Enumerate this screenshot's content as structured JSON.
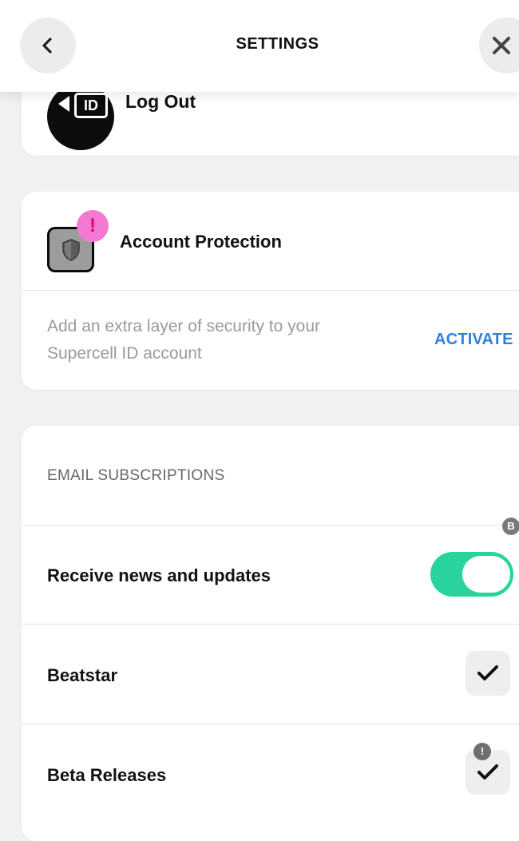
{
  "header": {
    "title": "SETTINGS",
    "back_icon": "chevron-left-icon",
    "close_icon": "close-icon"
  },
  "logout": {
    "label": "Log Out",
    "icon_text": "ID"
  },
  "account_protection": {
    "title": "Account Protection",
    "alert_mark": "!",
    "description": "Add an extra layer of security to your Supercell ID account",
    "action_label": "ACTIVATE"
  },
  "subscriptions": {
    "heading": "EMAIL SUBSCRIPTIONS",
    "news_label": "Receive news and updates",
    "news_enabled": true,
    "news_badge": "B",
    "items": [
      {
        "label": "Beatstar",
        "checked": true
      },
      {
        "label": "Beta Releases",
        "checked": true,
        "badge": "!"
      }
    ]
  },
  "colors": {
    "accent_toggle": "#28d39d",
    "link_blue": "#2f7fe0",
    "alert_pink": "#f27ad3"
  }
}
